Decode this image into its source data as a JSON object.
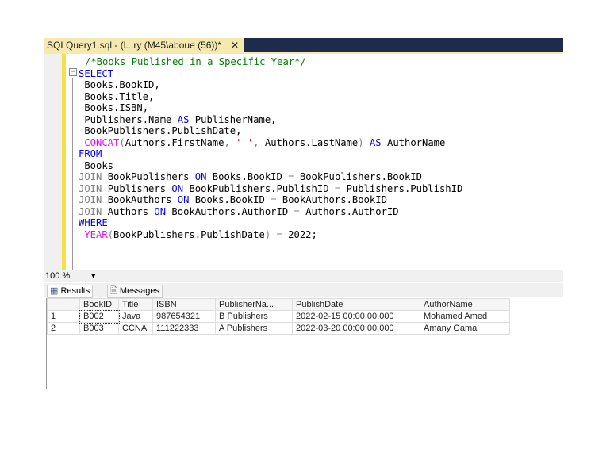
{
  "tab": {
    "title": "SQLQuery1.sql - (l...ry (M45\\aboue (56))*",
    "close": "✕"
  },
  "code": [
    [
      [
        "/*Books Published in a Specific Year*/",
        "cm"
      ]
    ],
    [
      [
        "SELECT",
        "kw"
      ]
    ],
    [
      [
        " Books.BookID,",
        "tx"
      ]
    ],
    [
      [
        " Books.Title,",
        "tx"
      ]
    ],
    [
      [
        " Books.ISBN,",
        "tx"
      ]
    ],
    [
      [
        " Publishers.Name ",
        "tx"
      ],
      [
        "AS",
        "kw"
      ],
      [
        " PublisherName,",
        "tx"
      ]
    ],
    [
      [
        " BookPublishers.PublishDate,",
        "tx"
      ]
    ],
    [
      [
        " CONCAT",
        "fn"
      ],
      [
        "(",
        "op"
      ],
      [
        "Authors.FirstName",
        "tx"
      ],
      [
        ", ",
        "op"
      ],
      [
        "' '",
        "st"
      ],
      [
        ", ",
        "op"
      ],
      [
        "Authors.LastName",
        "tx"
      ],
      [
        ") ",
        "op"
      ],
      [
        "AS",
        "kw"
      ],
      [
        " AuthorName",
        "tx"
      ]
    ],
    [
      [
        "FROM",
        "kw"
      ]
    ],
    [
      [
        " Books",
        "tx"
      ]
    ],
    [
      [
        "JOIN",
        "op"
      ],
      [
        " BookPublishers ",
        "tx"
      ],
      [
        "ON",
        "kw"
      ],
      [
        " Books.BookID ",
        "tx"
      ],
      [
        "=",
        "op"
      ],
      [
        " BookPublishers.BookID",
        "tx"
      ]
    ],
    [
      [
        "JOIN",
        "op"
      ],
      [
        " Publishers ",
        "tx"
      ],
      [
        "ON",
        "kw"
      ],
      [
        " BookPublishers.PublishID ",
        "tx"
      ],
      [
        "=",
        "op"
      ],
      [
        " Publishers.PublishID",
        "tx"
      ]
    ],
    [
      [
        "JOIN",
        "op"
      ],
      [
        " BookAuthors ",
        "tx"
      ],
      [
        "ON",
        "kw"
      ],
      [
        " Books.BookID ",
        "tx"
      ],
      [
        "=",
        "op"
      ],
      [
        " BookAuthors.BookID",
        "tx"
      ]
    ],
    [
      [
        "JOIN",
        "op"
      ],
      [
        " Authors ",
        "tx"
      ],
      [
        "ON",
        "kw"
      ],
      [
        " BookAuthors.AuthorID ",
        "tx"
      ],
      [
        "=",
        "op"
      ],
      [
        " Authors.AuthorID",
        "tx"
      ]
    ],
    [
      [
        "WHERE",
        "kw"
      ]
    ],
    [
      [
        " YEAR",
        "fn"
      ],
      [
        "(",
        "op"
      ],
      [
        "BookPublishers.PublishDate",
        "tx"
      ],
      [
        ")",
        "op"
      ],
      [
        " = ",
        "op"
      ],
      [
        "2022;",
        "tx"
      ]
    ]
  ],
  "zoom": {
    "value": "100 %",
    "dropdown": "▾"
  },
  "results_tabs": {
    "results": "Results",
    "messages": "Messages"
  },
  "grid": {
    "columns": [
      "",
      "BookID",
      "Title",
      "ISBN",
      "PublisherNa...",
      "PublishDate",
      "AuthorName"
    ],
    "rows": [
      [
        "1",
        "B002",
        "Java",
        "987654321",
        "B Publishers",
        "2022-02-15 00:00:00.000",
        "Mohamed Amed"
      ],
      [
        "2",
        "B003",
        "CCNA",
        "111222333",
        "A Publishers",
        "2022-03-20 00:00:00.000",
        "Amany Gamal"
      ]
    ]
  }
}
